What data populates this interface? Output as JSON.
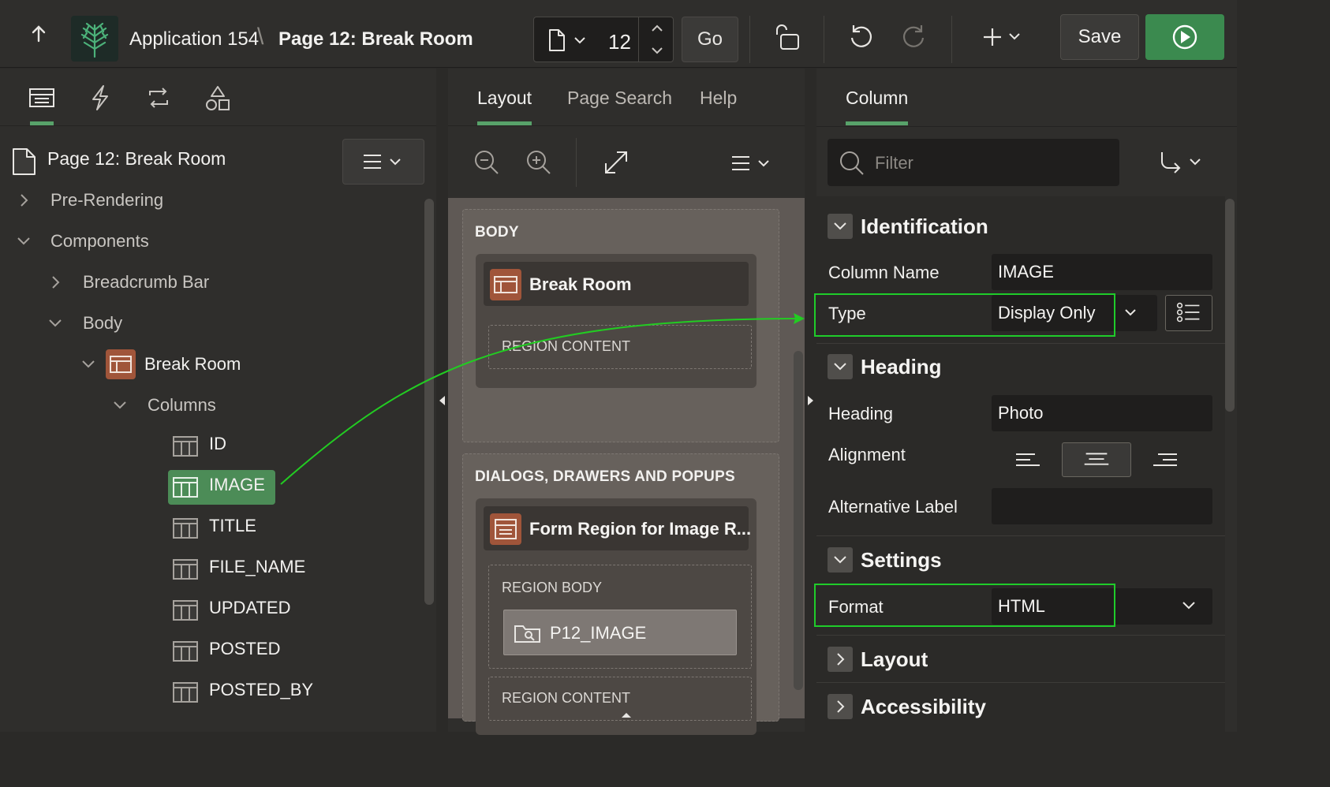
{
  "header": {
    "app_name": "Application 154",
    "separator": "\\",
    "page_name": "Page 12: Break Room",
    "page_number": "12",
    "go_label": "Go",
    "save_label": "Save"
  },
  "left": {
    "page_title": "Page 12: Break Room",
    "tree": {
      "pre_rendering": "Pre-Rendering",
      "components": "Components",
      "breadcrumb_bar": "Breadcrumb Bar",
      "body": "Body",
      "break_room": "Break Room",
      "columns": "Columns",
      "cols": [
        "ID",
        "IMAGE",
        "TITLE",
        "FILE_NAME",
        "UPDATED",
        "POSTED",
        "POSTED_BY"
      ]
    }
  },
  "middle": {
    "tabs": [
      "Layout",
      "Page Search",
      "Help"
    ],
    "body_title": "BODY",
    "break_room": "Break Room",
    "region_content": "REGION CONTENT",
    "dialogs_title": "DIALOGS, DRAWERS AND POPUPS",
    "form_region": "Form Region for Image R...",
    "region_body": "REGION BODY",
    "item": "P12_IMAGE",
    "region_content_2": "REGION CONTENT"
  },
  "right": {
    "tab": "Column",
    "filter_placeholder": "Filter",
    "identification": "Identification",
    "column_name_label": "Column Name",
    "column_name_value": "IMAGE",
    "type_label": "Type",
    "type_value": "Display Only",
    "heading_section": "Heading",
    "heading_label": "Heading",
    "heading_value": "Photo",
    "alignment_label": "Alignment",
    "alt_label": "Alternative Label",
    "settings": "Settings",
    "format_label": "Format",
    "format_value": "HTML",
    "layout": "Layout",
    "accessibility": "Accessibility"
  },
  "colors": {
    "accent_green": "#58a26a",
    "run_green": "#3b8a4f",
    "highlight": "#1fcc2a",
    "region_orange": "#a0553a"
  }
}
